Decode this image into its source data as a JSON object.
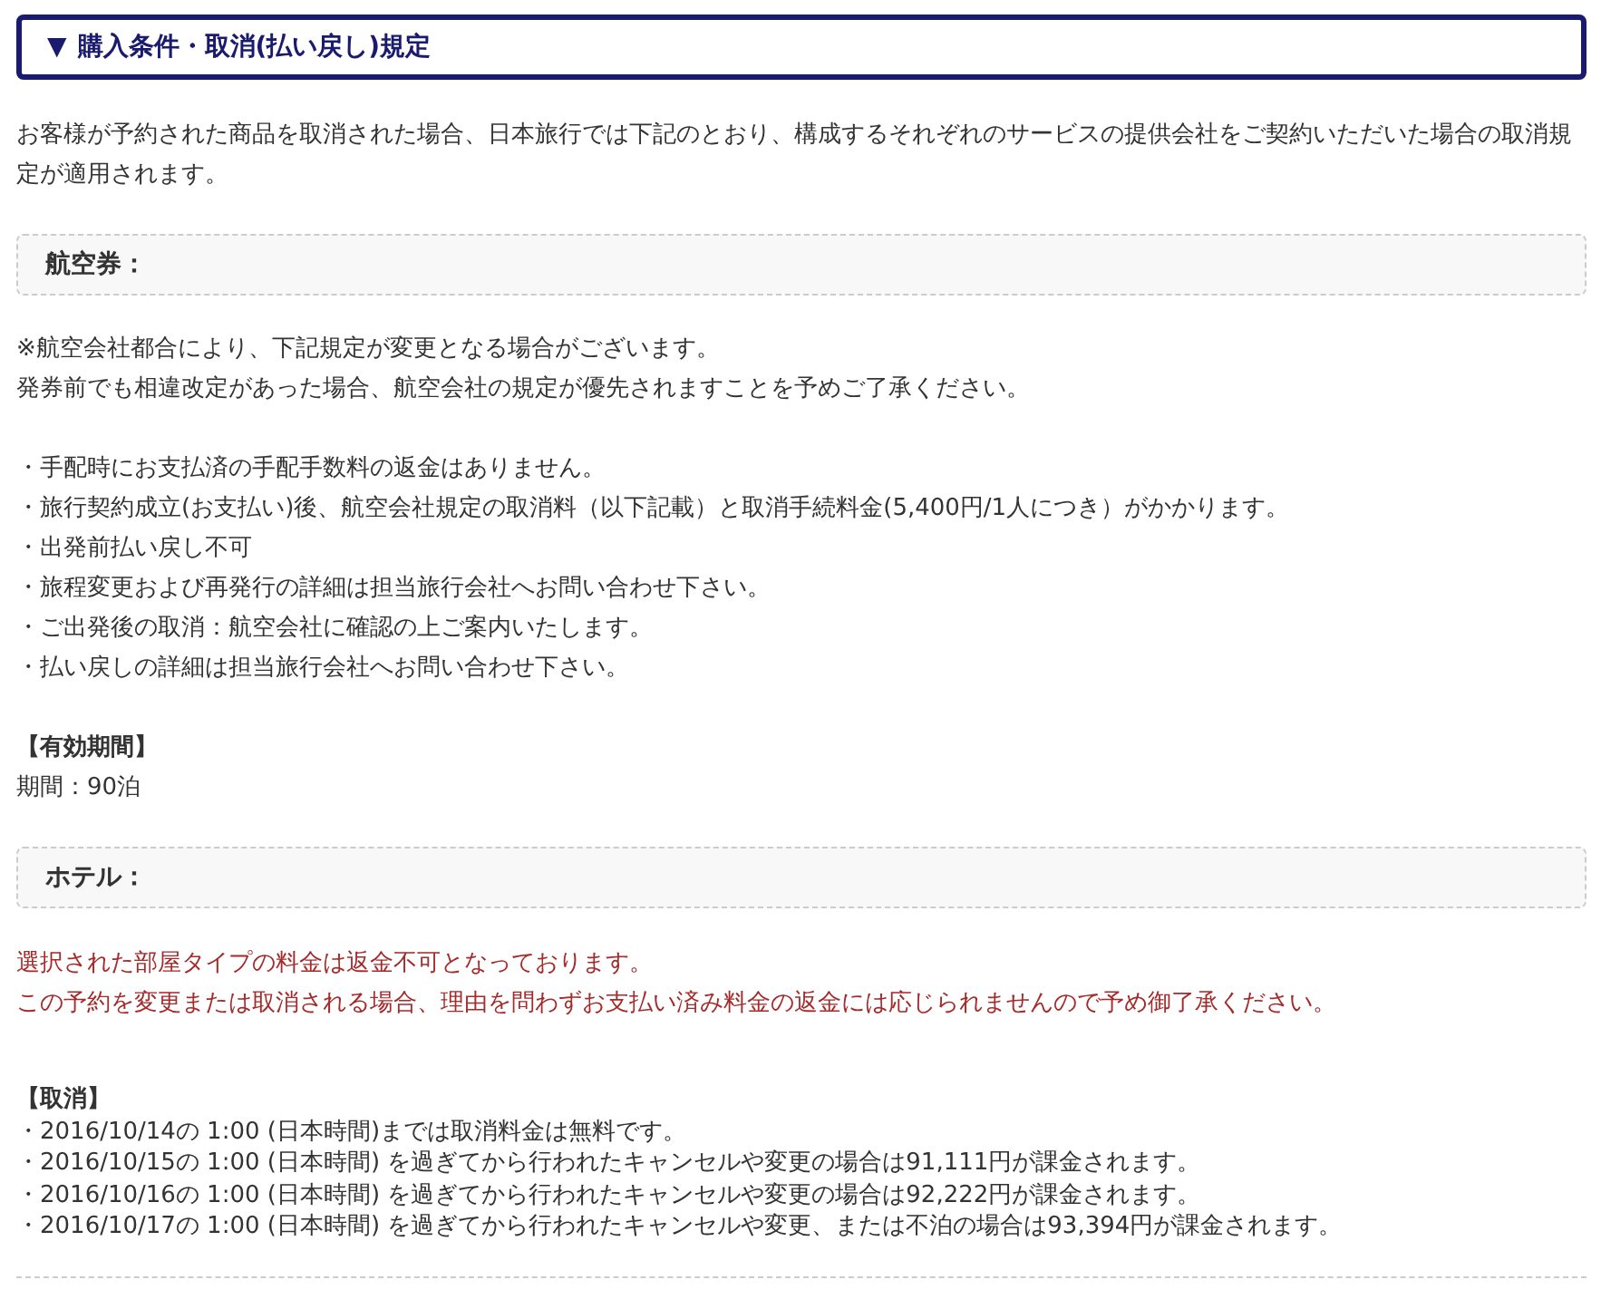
{
  "header": {
    "marker": "▼",
    "title": "購入条件・取消(払い戻し)規定"
  },
  "intro": "お客様が予約された商品を取消された場合、日本旅行では下記のとおり、構成するそれぞれのサービスの提供会社をご契約いただいた場合の取消規定が適用されます。",
  "sections": [
    {
      "heading": "航空券：",
      "blocks": [
        {
          "kind": "note",
          "lines": [
            "※航空会社都合により、下記規定が変更となる場合がございます。",
            "発券前でも相違改定があった場合、航空会社の規定が優先されますことを予めご了承ください。"
          ]
        },
        {
          "kind": "list",
          "lines": [
            "・手配時にお支払済の手配手数料の返金はありません。",
            "・旅行契約成立(お支払い)後、航空会社規定の取消料（以下記載）と取消手続料金(5,400円/1人につき）がかかります。",
            "・出発前払い戻し不可",
            "・旅程変更および再発行の詳細は担当旅行会社へお問い合わせ下さい。",
            "・ご出発後の取消：航空会社に確認の上ご案内いたします。",
            "・払い戻しの詳細は担当旅行会社へお問い合わせ下さい。"
          ]
        },
        {
          "kind": "labeled",
          "label": "【有効期間】",
          "lines": [
            "期間：90泊"
          ]
        }
      ]
    },
    {
      "heading": "ホテル：",
      "blocks": [
        {
          "kind": "notice",
          "lines": [
            "選択された部屋タイプの料金は返金不可となっております。",
            "この予約を変更または取消される場合、理由を問わずお支払い済み料金の返金には応じられませんので予め御了承ください。"
          ]
        },
        {
          "kind": "policy",
          "label": "【取消】",
          "lines": [
            "・2016/10/14の 1:00 (日本時間)までは取消料金は無料です。",
            "・2016/10/15の 1:00 (日本時間) を過ぎてから行われたキャンセルや変更の場合は91,111円が課金されます。",
            "・2016/10/16の 1:00 (日本時間) を過ぎてから行われたキャンセルや変更の場合は92,222円が課金されます。",
            "・2016/10/17の 1:00 (日本時間) を過ぎてから行われたキャンセルや変更、または不泊の場合は93,394円が課金されます。"
          ]
        }
      ]
    }
  ]
}
